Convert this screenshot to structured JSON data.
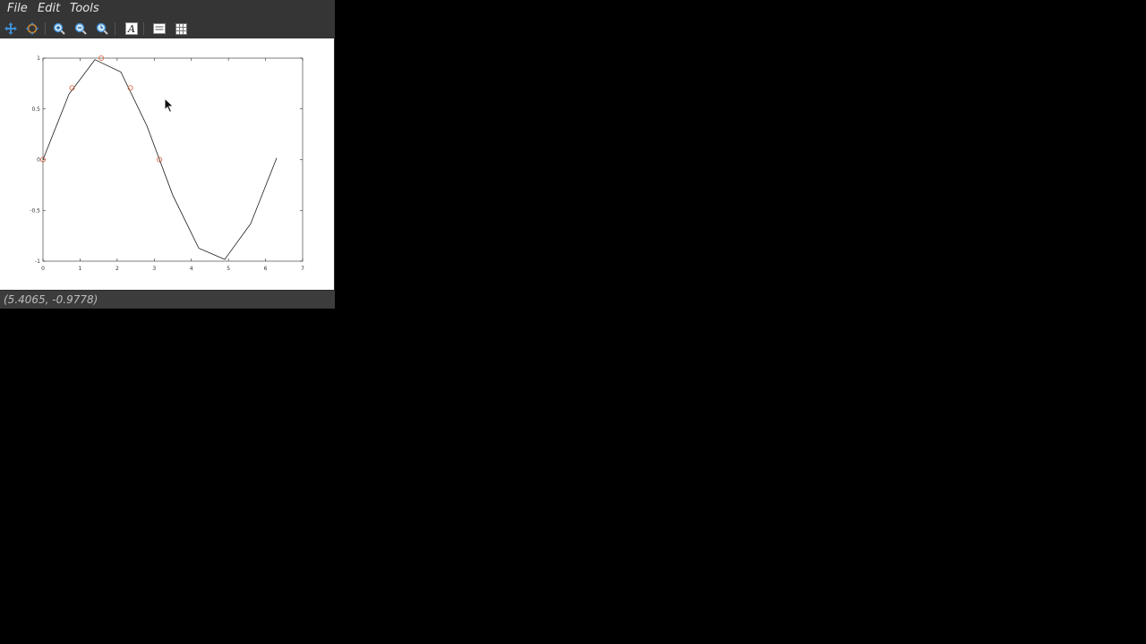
{
  "menu": {
    "items": [
      {
        "label": "File"
      },
      {
        "label": "Edit"
      },
      {
        "label": "Tools"
      }
    ]
  },
  "toolbar": {
    "buttons": [
      {
        "icon": "pan-icon",
        "name": "pan-button"
      },
      {
        "icon": "rotate-icon",
        "name": "rotate-button"
      },
      {
        "icon": "zoom-in-icon",
        "name": "zoom-in-button"
      },
      {
        "icon": "zoom-out-icon",
        "name": "zoom-out-button"
      },
      {
        "icon": "zoom-reset-icon",
        "name": "zoom-reset-button"
      },
      {
        "icon": "insert-text-icon",
        "name": "insert-text-button"
      },
      {
        "icon": "toggle-axes-icon",
        "name": "toggle-axes-button"
      },
      {
        "icon": "toggle-grid-icon",
        "name": "toggle-grid-button"
      }
    ],
    "insert_text_glyph": "A"
  },
  "status": {
    "coordinates": "(5.4065, -0.9778)"
  },
  "colors": {
    "line": "#1a1a1a",
    "markers": "#d9603b",
    "background": "#000000",
    "figure": "#ffffff"
  },
  "chart_data": {
    "type": "line",
    "title": "",
    "xlabel": "",
    "ylabel": "",
    "xlim": [
      0,
      7
    ],
    "ylim": [
      -1,
      1
    ],
    "xticks": [
      "0",
      "1",
      "2",
      "3",
      "4",
      "5",
      "6",
      "7"
    ],
    "yticks": [
      "-1",
      "-0.5",
      "0",
      "0.5",
      "1"
    ],
    "series": [
      {
        "style": "line",
        "x": [
          0,
          0.7,
          1.4,
          2.1,
          2.8,
          3.5,
          4.2,
          4.9,
          5.6,
          6.3
        ],
        "y": [
          0,
          0.644,
          0.985,
          0.863,
          0.335,
          -0.351,
          -0.872,
          -0.982,
          -0.631,
          0.017
        ]
      },
      {
        "style": "markers",
        "x": [
          0,
          0.785,
          1.571,
          2.356,
          3.142
        ],
        "y": [
          0,
          0.707,
          1,
          0.707,
          0
        ]
      }
    ]
  }
}
